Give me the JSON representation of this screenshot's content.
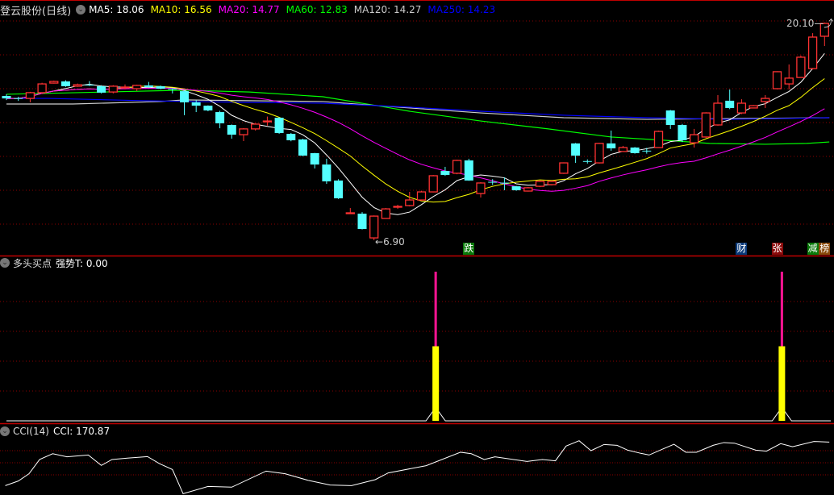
{
  "header": {
    "title": "登云股份(日线)",
    "ma_labels": [
      {
        "text": "MA5: 18.06",
        "color": "#ffffff"
      },
      {
        "text": "MA10: 16.56",
        "color": "#ffff00"
      },
      {
        "text": "MA20: 14.77",
        "color": "#ff00ff"
      },
      {
        "text": "MA60: 12.83",
        "color": "#00ff00"
      },
      {
        "text": "MA120: 14.27",
        "color": "#cccccc"
      },
      {
        "text": "MA250: 14.23",
        "color": "#0000ff"
      }
    ]
  },
  "price_markers": {
    "high": "20.10",
    "low": "6.90",
    "high_arrow": "←",
    "low_arrow": "←"
  },
  "event_tags": [
    {
      "text": "跌",
      "index": 39,
      "bg": "#0a7a0a"
    },
    {
      "text": "财",
      "index": 62,
      "bg": "#0a3a7a"
    },
    {
      "text": "张",
      "index": 65,
      "bg": "#8a0a0a"
    },
    {
      "text": "减",
      "index": 68,
      "bg": "#0a7a0a"
    },
    {
      "text": "榜",
      "index": 69,
      "bg": "#8a4a0a"
    }
  ],
  "indicator1": {
    "name": "多头买点",
    "value_label": "强势T: 0.00"
  },
  "indicator2": {
    "name": "CCI(14)",
    "value_label": "CCI: 170.87"
  },
  "colors": {
    "up": "#ff3232",
    "down": "#54ffff",
    "grid": "#8b0000",
    "border": "#c00000",
    "strong": "#ff1493",
    "buy": "#ffff00"
  },
  "chart_data": [
    {
      "type": "candlestick",
      "title": "登云股份(日线)",
      "ylim": [
        6.9,
        20.1
      ],
      "ohlc_note": "[open, close, high, low]",
      "candles": [
        [
          15.65,
          15.5,
          15.75,
          15.4
        ],
        [
          15.52,
          15.5,
          15.6,
          15.35
        ],
        [
          15.5,
          15.85,
          15.9,
          15.26
        ],
        [
          15.85,
          16.38,
          16.45,
          15.8
        ],
        [
          16.43,
          16.53,
          16.58,
          16.4
        ],
        [
          16.53,
          16.24,
          16.6,
          16.2
        ],
        [
          16.24,
          16.33,
          16.4,
          16.2
        ],
        [
          16.33,
          16.31,
          16.55,
          16.25
        ],
        [
          16.24,
          15.85,
          16.3,
          15.8
        ],
        [
          15.89,
          16.24,
          16.3,
          15.8
        ],
        [
          16.17,
          16.19,
          16.35,
          16.05
        ],
        [
          16.09,
          16.29,
          16.33,
          15.95
        ],
        [
          16.29,
          16.19,
          16.5,
          16.15
        ],
        [
          16.24,
          16.09,
          16.28,
          16.05
        ],
        [
          16.09,
          16.04,
          16.12,
          15.8
        ],
        [
          15.94,
          15.26,
          15.98,
          14.48
        ],
        [
          15.26,
          15.06,
          15.4,
          14.67
        ],
        [
          15.06,
          14.77,
          15.08,
          14.72
        ],
        [
          14.67,
          13.99,
          14.75,
          13.69
        ],
        [
          13.89,
          13.3,
          13.92,
          13.06
        ],
        [
          13.3,
          13.65,
          13.7,
          12.91
        ],
        [
          13.65,
          13.94,
          14.0,
          13.55
        ],
        [
          14.1,
          14.13,
          14.4,
          13.85
        ],
        [
          14.33,
          13.4,
          14.35,
          13.35
        ],
        [
          13.35,
          12.96,
          13.4,
          12.9
        ],
        [
          13.01,
          12.03,
          13.05,
          12.0
        ],
        [
          12.18,
          11.49,
          12.2,
          11.25
        ],
        [
          11.49,
          10.47,
          11.84,
          10.32
        ],
        [
          10.52,
          9.44,
          10.6,
          9.4
        ],
        [
          8.56,
          8.56,
          8.85,
          8.56
        ],
        [
          8.51,
          7.58,
          8.6,
          7.55
        ],
        [
          7.04,
          8.36,
          8.4,
          6.9
        ],
        [
          8.22,
          8.8,
          8.85,
          8.2
        ],
        [
          8.93,
          8.95,
          9.05,
          8.8
        ],
        [
          9.0,
          9.34,
          9.83,
          8.95
        ],
        [
          9.34,
          9.83,
          9.9,
          9.3
        ],
        [
          9.83,
          10.81,
          10.85,
          9.8
        ],
        [
          11.1,
          10.86,
          11.35,
          10.8
        ],
        [
          10.96,
          11.74,
          11.78,
          10.9
        ],
        [
          11.74,
          10.52,
          11.84,
          10.5
        ],
        [
          9.73,
          10.37,
          10.42,
          9.49
        ],
        [
          10.44,
          10.42,
          10.6,
          10.25
        ],
        [
          10.39,
          10.37,
          10.71,
          9.93
        ],
        [
          10.17,
          9.93,
          10.2,
          9.9
        ],
        [
          9.88,
          10.08,
          10.12,
          9.85
        ],
        [
          10.17,
          10.47,
          10.52,
          10.12
        ],
        [
          10.27,
          10.47,
          10.5,
          10.22
        ],
        [
          10.96,
          11.59,
          11.62,
          10.92
        ],
        [
          12.77,
          12.03,
          12.8,
          11.59
        ],
        [
          11.7,
          11.68,
          11.8,
          11.55
        ],
        [
          11.59,
          12.77,
          12.8,
          11.55
        ],
        [
          12.77,
          12.47,
          13.55,
          12.33
        ],
        [
          12.28,
          12.52,
          12.62,
          12.25
        ],
        [
          12.52,
          12.18,
          12.55,
          12.15
        ],
        [
          12.33,
          12.31,
          12.5,
          12.15
        ],
        [
          12.52,
          13.5,
          13.55,
          12.5
        ],
        [
          14.77,
          13.89,
          14.8,
          13.65
        ],
        [
          13.89,
          12.96,
          13.95,
          12.85
        ],
        [
          12.81,
          13.3,
          13.65,
          12.52
        ],
        [
          13.16,
          14.62,
          14.66,
          13.1
        ],
        [
          13.89,
          15.21,
          15.7,
          13.85
        ],
        [
          15.36,
          14.92,
          16.04,
          14.85
        ],
        [
          14.62,
          15.21,
          15.45,
          14.55
        ],
        [
          14.92,
          15.06,
          15.1,
          14.9
        ],
        [
          15.31,
          15.5,
          15.7,
          14.92
        ],
        [
          16.09,
          17.12,
          17.15,
          16.05
        ],
        [
          16.38,
          16.73,
          17.56,
          16.04
        ],
        [
          16.77,
          18.0,
          18.1,
          16.75
        ],
        [
          17.31,
          19.22,
          19.46,
          17.25
        ],
        [
          19.27,
          20.05,
          20.1,
          18.68
        ]
      ],
      "computed_ma": [
        {
          "name": "MA5",
          "period": 5,
          "color": "#ffffff"
        },
        {
          "name": "MA10",
          "period": 10,
          "color": "#ffff00"
        },
        {
          "name": "MA20",
          "period": 20,
          "color": "#ff00ff"
        }
      ],
      "long_ma_anchor_note": "[candle index, price]",
      "long_ma": [
        {
          "name": "MA60",
          "color": "#00ff00",
          "points": [
            [
              0,
              15.75
            ],
            [
              15,
              16.0
            ],
            [
              20.5,
              15.89
            ],
            [
              26.7,
              15.6
            ],
            [
              32,
              14.97
            ],
            [
              34,
              14.72
            ],
            [
              40,
              14.13
            ],
            [
              45.7,
              13.65
            ],
            [
              51,
              13.16
            ],
            [
              56.6,
              12.91
            ],
            [
              59.3,
              12.77
            ],
            [
              64,
              12.72
            ],
            [
              67.5,
              12.77
            ],
            [
              69.4,
              12.86
            ]
          ]
        },
        {
          "name": "MA120",
          "color": "#cccccc",
          "points": [
            [
              0,
              15.16
            ],
            [
              5.6,
              15.16
            ],
            [
              13,
              15.31
            ],
            [
              15,
              15.41
            ],
            [
              26.7,
              15.31
            ],
            [
              34,
              14.92
            ],
            [
              40,
              14.62
            ],
            [
              47,
              14.33
            ],
            [
              54,
              14.23
            ],
            [
              69.4,
              14.33
            ]
          ]
        },
        {
          "name": "MA250",
          "color": "#0000ff",
          "points": [
            [
              0,
              15.5
            ],
            [
              3.5,
              15.5
            ],
            [
              11.7,
              15.36
            ],
            [
              20,
              15.26
            ],
            [
              26.7,
              15.21
            ],
            [
              34,
              14.97
            ],
            [
              40,
              14.72
            ],
            [
              47,
              14.48
            ],
            [
              54,
              14.33
            ],
            [
              60.7,
              14.23
            ],
            [
              69.4,
              14.33
            ]
          ]
        }
      ]
    },
    {
      "type": "bar",
      "title": "多头买点",
      "ylim": [
        0,
        100
      ],
      "signals": [
        {
          "index": 36.2,
          "strong": 100,
          "buy": 50
        },
        {
          "index": 65.4,
          "strong": 100,
          "buy": 50
        }
      ],
      "t_line_peak": 9
    },
    {
      "type": "line",
      "title": "CCI(14)",
      "ylim": [
        -300,
        330
      ],
      "gridlines": [
        100,
        0,
        -100
      ],
      "x": [
        -0.1,
        1.0,
        1.9,
        2.8,
        3.9,
        5.1,
        6.9,
        8.0,
        8.9,
        10.2,
        11.9,
        12.9,
        14.0,
        14.9,
        17.0,
        19.0,
        21.9,
        23.5,
        25.5,
        27.3,
        29.1,
        31.1,
        32.2,
        35.4,
        38.3,
        39.2,
        40.3,
        41.2,
        43.9,
        45.2,
        46.3,
        47.2,
        48.3,
        49.3,
        50.4,
        51.5,
        52.4,
        53.5,
        54.2,
        55.3,
        56.3,
        57.3,
        58.2,
        59.6,
        60.5,
        61.4,
        63.2,
        64.1,
        65.3,
        66.3,
        68.1,
        69.4
      ],
      "values": [
        -189,
        -151,
        -91,
        27,
        75,
        49,
        64,
        -22,
        27,
        38,
        51,
        -7,
        -56,
        -256,
        -196,
        -202,
        -69,
        -91,
        -147,
        -184,
        -189,
        -140,
        -84,
        -24,
        87,
        75,
        27,
        49,
        11,
        27,
        16,
        138,
        182,
        100,
        151,
        144,
        104,
        78,
        64,
        111,
        153,
        87,
        87,
        144,
        167,
        162,
        104,
        96,
        158,
        133,
        176,
        171
      ]
    }
  ]
}
